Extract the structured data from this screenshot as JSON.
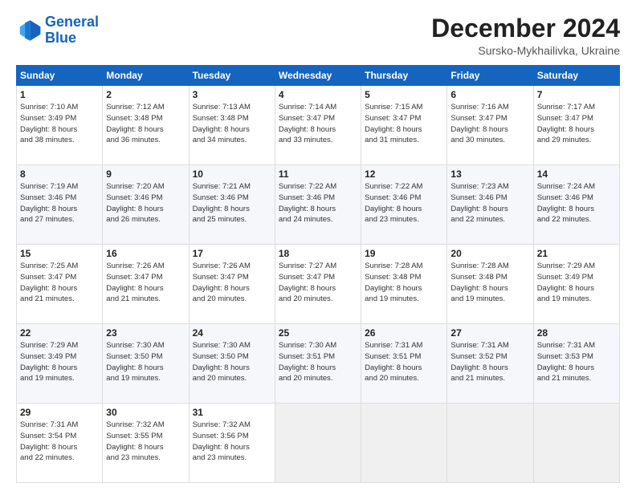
{
  "logo": {
    "line1": "General",
    "line2": "Blue"
  },
  "header": {
    "month": "December 2024",
    "location": "Sursko-Mykhailivka, Ukraine"
  },
  "weekdays": [
    "Sunday",
    "Monday",
    "Tuesday",
    "Wednesday",
    "Thursday",
    "Friday",
    "Saturday"
  ],
  "weeks": [
    [
      {
        "day": "1",
        "info": "Sunrise: 7:10 AM\nSunset: 3:49 PM\nDaylight: 8 hours\nand 38 minutes."
      },
      {
        "day": "2",
        "info": "Sunrise: 7:12 AM\nSunset: 3:48 PM\nDaylight: 8 hours\nand 36 minutes."
      },
      {
        "day": "3",
        "info": "Sunrise: 7:13 AM\nSunset: 3:48 PM\nDaylight: 8 hours\nand 34 minutes."
      },
      {
        "day": "4",
        "info": "Sunrise: 7:14 AM\nSunset: 3:47 PM\nDaylight: 8 hours\nand 33 minutes."
      },
      {
        "day": "5",
        "info": "Sunrise: 7:15 AM\nSunset: 3:47 PM\nDaylight: 8 hours\nand 31 minutes."
      },
      {
        "day": "6",
        "info": "Sunrise: 7:16 AM\nSunset: 3:47 PM\nDaylight: 8 hours\nand 30 minutes."
      },
      {
        "day": "7",
        "info": "Sunrise: 7:17 AM\nSunset: 3:47 PM\nDaylight: 8 hours\nand 29 minutes."
      }
    ],
    [
      {
        "day": "8",
        "info": "Sunrise: 7:19 AM\nSunset: 3:46 PM\nDaylight: 8 hours\nand 27 minutes."
      },
      {
        "day": "9",
        "info": "Sunrise: 7:20 AM\nSunset: 3:46 PM\nDaylight: 8 hours\nand 26 minutes."
      },
      {
        "day": "10",
        "info": "Sunrise: 7:21 AM\nSunset: 3:46 PM\nDaylight: 8 hours\nand 25 minutes."
      },
      {
        "day": "11",
        "info": "Sunrise: 7:22 AM\nSunset: 3:46 PM\nDaylight: 8 hours\nand 24 minutes."
      },
      {
        "day": "12",
        "info": "Sunrise: 7:22 AM\nSunset: 3:46 PM\nDaylight: 8 hours\nand 23 minutes."
      },
      {
        "day": "13",
        "info": "Sunrise: 7:23 AM\nSunset: 3:46 PM\nDaylight: 8 hours\nand 22 minutes."
      },
      {
        "day": "14",
        "info": "Sunrise: 7:24 AM\nSunset: 3:46 PM\nDaylight: 8 hours\nand 22 minutes."
      }
    ],
    [
      {
        "day": "15",
        "info": "Sunrise: 7:25 AM\nSunset: 3:47 PM\nDaylight: 8 hours\nand 21 minutes."
      },
      {
        "day": "16",
        "info": "Sunrise: 7:26 AM\nSunset: 3:47 PM\nDaylight: 8 hours\nand 21 minutes."
      },
      {
        "day": "17",
        "info": "Sunrise: 7:26 AM\nSunset: 3:47 PM\nDaylight: 8 hours\nand 20 minutes."
      },
      {
        "day": "18",
        "info": "Sunrise: 7:27 AM\nSunset: 3:47 PM\nDaylight: 8 hours\nand 20 minutes."
      },
      {
        "day": "19",
        "info": "Sunrise: 7:28 AM\nSunset: 3:48 PM\nDaylight: 8 hours\nand 19 minutes."
      },
      {
        "day": "20",
        "info": "Sunrise: 7:28 AM\nSunset: 3:48 PM\nDaylight: 8 hours\nand 19 minutes."
      },
      {
        "day": "21",
        "info": "Sunrise: 7:29 AM\nSunset: 3:49 PM\nDaylight: 8 hours\nand 19 minutes."
      }
    ],
    [
      {
        "day": "22",
        "info": "Sunrise: 7:29 AM\nSunset: 3:49 PM\nDaylight: 8 hours\nand 19 minutes."
      },
      {
        "day": "23",
        "info": "Sunrise: 7:30 AM\nSunset: 3:50 PM\nDaylight: 8 hours\nand 19 minutes."
      },
      {
        "day": "24",
        "info": "Sunrise: 7:30 AM\nSunset: 3:50 PM\nDaylight: 8 hours\nand 20 minutes."
      },
      {
        "day": "25",
        "info": "Sunrise: 7:30 AM\nSunset: 3:51 PM\nDaylight: 8 hours\nand 20 minutes."
      },
      {
        "day": "26",
        "info": "Sunrise: 7:31 AM\nSunset: 3:51 PM\nDaylight: 8 hours\nand 20 minutes."
      },
      {
        "day": "27",
        "info": "Sunrise: 7:31 AM\nSunset: 3:52 PM\nDaylight: 8 hours\nand 21 minutes."
      },
      {
        "day": "28",
        "info": "Sunrise: 7:31 AM\nSunset: 3:53 PM\nDaylight: 8 hours\nand 21 minutes."
      }
    ],
    [
      {
        "day": "29",
        "info": "Sunrise: 7:31 AM\nSunset: 3:54 PM\nDaylight: 8 hours\nand 22 minutes."
      },
      {
        "day": "30",
        "info": "Sunrise: 7:32 AM\nSunset: 3:55 PM\nDaylight: 8 hours\nand 23 minutes."
      },
      {
        "day": "31",
        "info": "Sunrise: 7:32 AM\nSunset: 3:56 PM\nDaylight: 8 hours\nand 23 minutes."
      },
      null,
      null,
      null,
      null
    ]
  ]
}
